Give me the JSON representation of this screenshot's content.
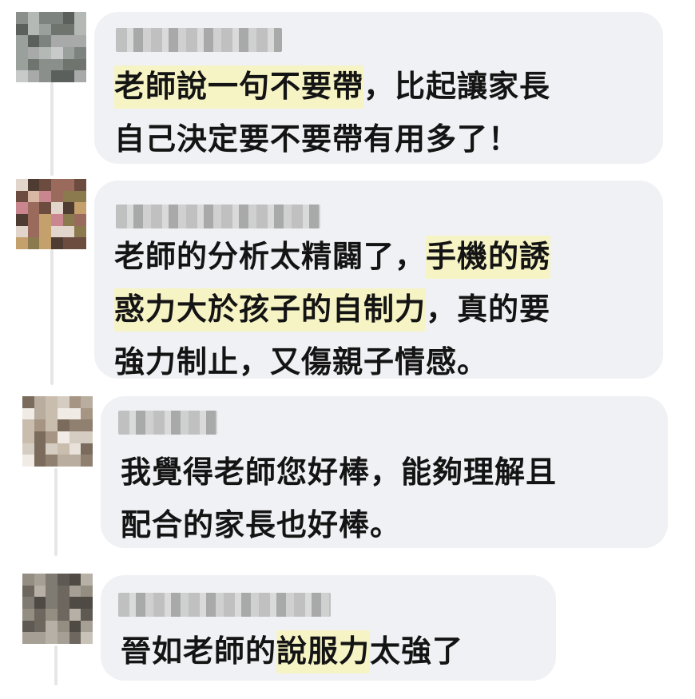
{
  "comments": [
    {
      "lines": [
        [
          {
            "t": "老師說一句不要帶",
            "hl": true
          },
          {
            "t": "，比起讓家長"
          }
        ],
        [
          {
            "t": "自己決定要不要帶有用多了！"
          }
        ]
      ]
    },
    {
      "lines": [
        [
          {
            "t": "老師的分析太精闢了，"
          },
          {
            "t": "手機的誘",
            "hl": true
          }
        ],
        [
          {
            "t": "惑力大於孩子的自制力",
            "hl": true
          },
          {
            "t": "，真的要"
          }
        ],
        [
          {
            "t": "強力制止，又傷親子情感。"
          }
        ]
      ]
    },
    {
      "lines": [
        [
          {
            "t": "我覺得老師您好棒，能夠理解且"
          }
        ],
        [
          {
            "t": "配合的家長也好棒。"
          }
        ]
      ]
    },
    {
      "lines": [
        [
          {
            "t": "晉如老師的"
          },
          {
            "t": "說服力",
            "hl": true
          },
          {
            "t": "太強了"
          }
        ]
      ]
    }
  ],
  "colors": {
    "bubble": "#f0f1f4",
    "highlight": "#f6f4c5",
    "text": "#141414",
    "thread_line": "#e6e6e6"
  }
}
